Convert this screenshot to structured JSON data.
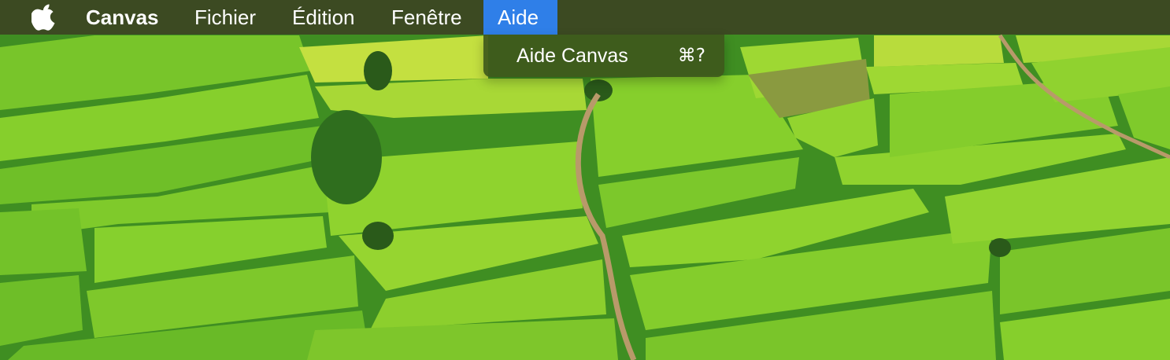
{
  "menubar": {
    "apple_icon": "apple-logo-icon",
    "app_name": "Canvas",
    "items": [
      "Fichier",
      "Édition",
      "Fenêtre",
      "Aide"
    ],
    "active_item": "Aide",
    "background_color": "#3c4a22",
    "active_color": "#2f7fe8"
  },
  "dropdown": {
    "items": [
      {
        "label": "Aide Canvas",
        "shortcut": "⌘?"
      }
    ]
  },
  "wallpaper": {
    "subject": "green rice terraces",
    "colors": {
      "field_light": "#9ddc32",
      "field_mid": "#6cc227",
      "field_dark": "#3f8e22",
      "path": "#b89a6a"
    }
  }
}
